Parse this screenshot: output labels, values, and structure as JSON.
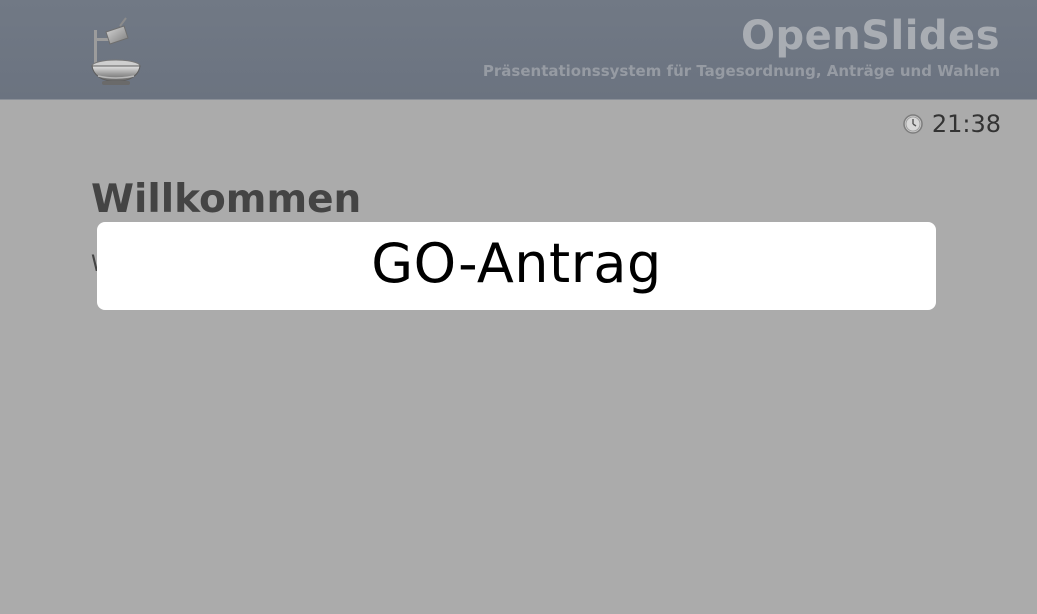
{
  "header": {
    "logo_icon": "overhead-projector-icon",
    "title": "OpenSlides",
    "subtitle": "Präsentationssystem für Tagesordnung, Anträge und Wahlen"
  },
  "clock": {
    "icon": "clock-icon",
    "time": "21:38"
  },
  "main": {
    "title": "Willkommen",
    "text_fragment": "W"
  },
  "overlay": {
    "text": "GO-Antrag"
  },
  "colors": {
    "header_bg": "#717985",
    "page_bg": "#ababab",
    "overlay_bg": "#ffffff",
    "heading_text": "#444444"
  }
}
